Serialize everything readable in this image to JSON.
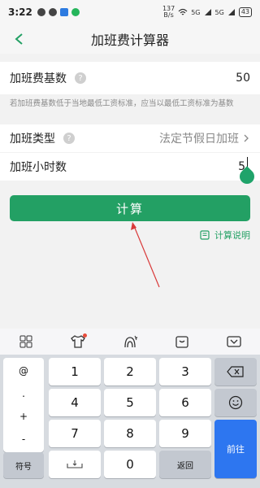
{
  "status": {
    "time": "3:22",
    "speed_top": "137",
    "speed_bottom": "B/s",
    "net1": "5G",
    "net2": "5G",
    "battery": "43"
  },
  "header": {
    "title": "加班费计算器"
  },
  "form": {
    "base_label": "加班费基数",
    "base_value": "50",
    "note": "若加班费基数低于当地最低工资标准，应当以最低工资标准为基数",
    "type_label": "加班类型",
    "type_value": "法定节假日加班",
    "hours_label": "加班小时数",
    "hours_value": "5"
  },
  "actions": {
    "calc_label": "计算",
    "explain_label": "计算说明"
  },
  "keyboard": {
    "symbols": [
      "@",
      ".",
      "+",
      "-"
    ],
    "digits": [
      "1",
      "2",
      "3",
      "4",
      "5",
      "6",
      "7",
      "8",
      "9",
      "0"
    ],
    "fuhao": "符号",
    "back": "返回",
    "go": "前往",
    "help_icon": "question-mark"
  },
  "colors": {
    "accent": "#23a064",
    "go_key": "#2d76f0"
  }
}
